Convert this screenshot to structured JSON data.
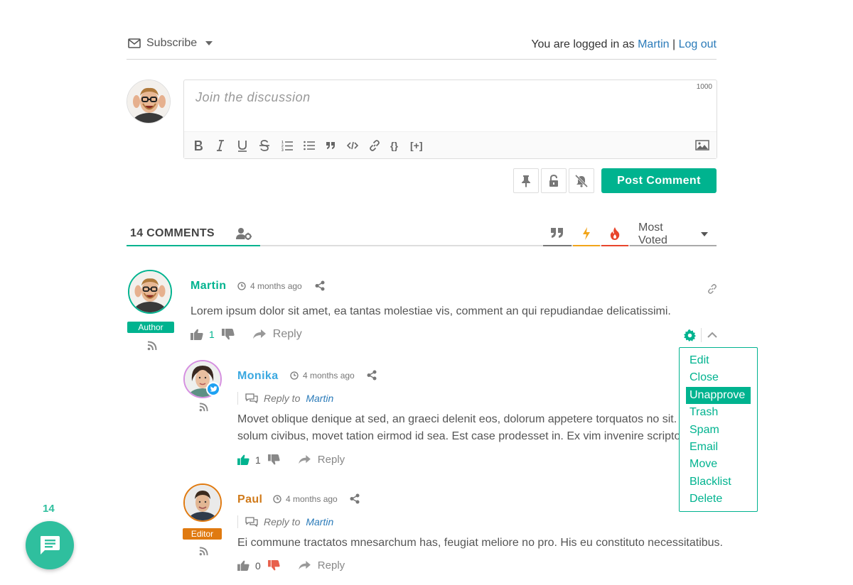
{
  "topbar": {
    "subscribe_label": "Subscribe",
    "logged_in_prefix": "You are logged in as",
    "username": "Martin",
    "separator": "|",
    "logout_label": "Log out"
  },
  "editor": {
    "placeholder": "Join the discussion",
    "char_limit": "1000",
    "toolbar": [
      "bold-icon",
      "italic-icon",
      "underline-icon",
      "strikethrough-icon",
      "ordered-list-icon",
      "unordered-list-icon",
      "quote-icon",
      "code-icon",
      "link-icon",
      "source-code-icon",
      "spoiler-icon",
      "image-icon"
    ],
    "spoiler_label": "[+]",
    "source_label": "{}",
    "post_button": "Post Comment"
  },
  "comments_header": {
    "count_label": "14 COMMENTS",
    "sort_label": "Most Voted",
    "sort_tab_colors": {
      "quotes": "#777777",
      "newest": "#f2a51a",
      "hot": "#e8452c"
    }
  },
  "comments": [
    {
      "author": "Martin",
      "author_color": "#00b38f",
      "role": "Author",
      "role_color": "#00b38f",
      "time": "4 months ago",
      "text": "Lorem ipsum dolor sit amet, ea tantas molestiae vis, comment an qui repudiandae delicatissimi.",
      "votes": "1",
      "reply_label": "Reply"
    },
    {
      "author": "Monika",
      "author_color": "#3aa8e0",
      "time": "4 months ago",
      "reply_to_label": "Reply to",
      "reply_to": "Martin",
      "text_line1": "Movet oblique denique at sed, an graeci delenit eos, dolorum appetere torquatos no sit. Ea",
      "text_line2": "solum civibus, movet tation eirmod id sea. Est case prodesset in. Ex vim invenire scriptorem",
      "votes": "1",
      "reply_label": "Reply"
    },
    {
      "author": "Paul",
      "author_color": "#d07a1a",
      "role": "Editor",
      "role_color": "#e07a10",
      "time": "4 months ago",
      "reply_to_label": "Reply to",
      "reply_to": "Martin",
      "text": "Ei commune tractatos mnesarchum has, feugiat meliore no pro. His eu constituto necessitatibus.",
      "votes": "0",
      "reply_label": "Reply"
    }
  ],
  "moderation_menu": {
    "items": [
      "Edit",
      "Close",
      "Unapprove",
      "Trash",
      "Spam",
      "Email",
      "Move",
      "Blacklist",
      "Delete"
    ],
    "active": "Unapprove"
  },
  "bubble": {
    "count": "14"
  }
}
